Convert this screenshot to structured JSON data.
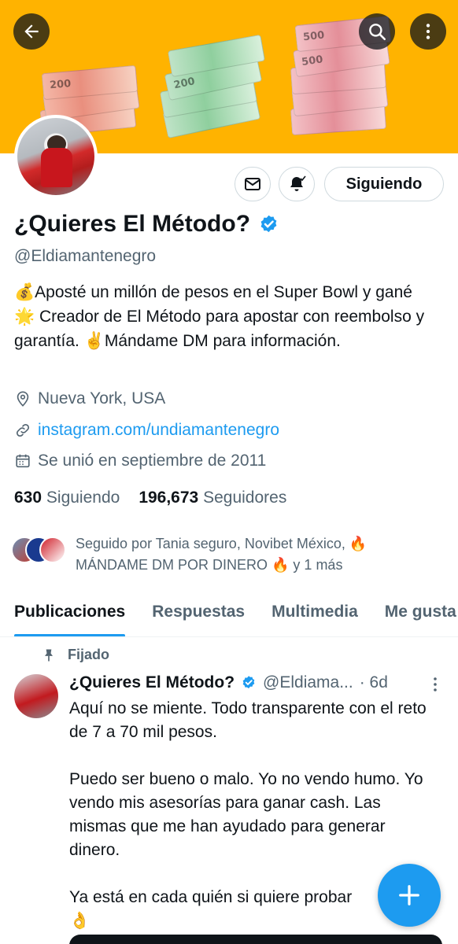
{
  "header": {
    "back_icon": "arrow-left-icon",
    "search_icon": "search-icon",
    "more_icon": "more-vertical-icon",
    "banner_bills": [
      "200",
      "200",
      "500",
      "500"
    ]
  },
  "profile": {
    "display_name": "¿Quieres El Método?",
    "handle": "@Eldiamantenegro",
    "bio": "💰Aposté un millón de pesos en el Super Bowl y gané 🌟 Creador de El Método para apostar con reembolso y garantía. ✌️Mándame DM para información.",
    "location": "Nueva York, USA",
    "website": "instagram.com/undiamantenegro",
    "joined": "Se unió en septiembre de 2011",
    "following_count": "630",
    "following_label": "Siguiendo",
    "followers_count": "196,673",
    "followers_label": "Seguidores",
    "followed_by": "Seguido por Tania seguro, Novibet México, 🔥 MÁNDAME DM POR DINERO 🔥 y 1 más"
  },
  "actions": {
    "message_icon": "mail-icon",
    "notify_icon": "bell-check-icon",
    "follow_label": "Siguiendo"
  },
  "tabs": [
    "Publicaciones",
    "Respuestas",
    "Multimedia",
    "Me gusta"
  ],
  "active_tab": "Publicaciones",
  "pinned_tweet": {
    "pinned_label": "Fijado",
    "author_name": "¿Quieres El Método?",
    "author_handle": "@Eldiama...",
    "time": "· 6d",
    "text": "Aquí no se miente. Todo transparente con el reto de 7 a 70 mil pesos.\n\nPuedo ser bueno o malo. Yo no vendo humo. Yo vendo mis asesorías para ganar cash. Las mismas que me han ayudado para generar dinero.\n\nYa está en cada quién si quiere probar\n👌"
  },
  "fab": {
    "icon": "plus-icon"
  },
  "colors": {
    "accent": "#1d9bf0",
    "banner": "#ffb300",
    "text": "#0f1419",
    "muted": "#536471"
  }
}
